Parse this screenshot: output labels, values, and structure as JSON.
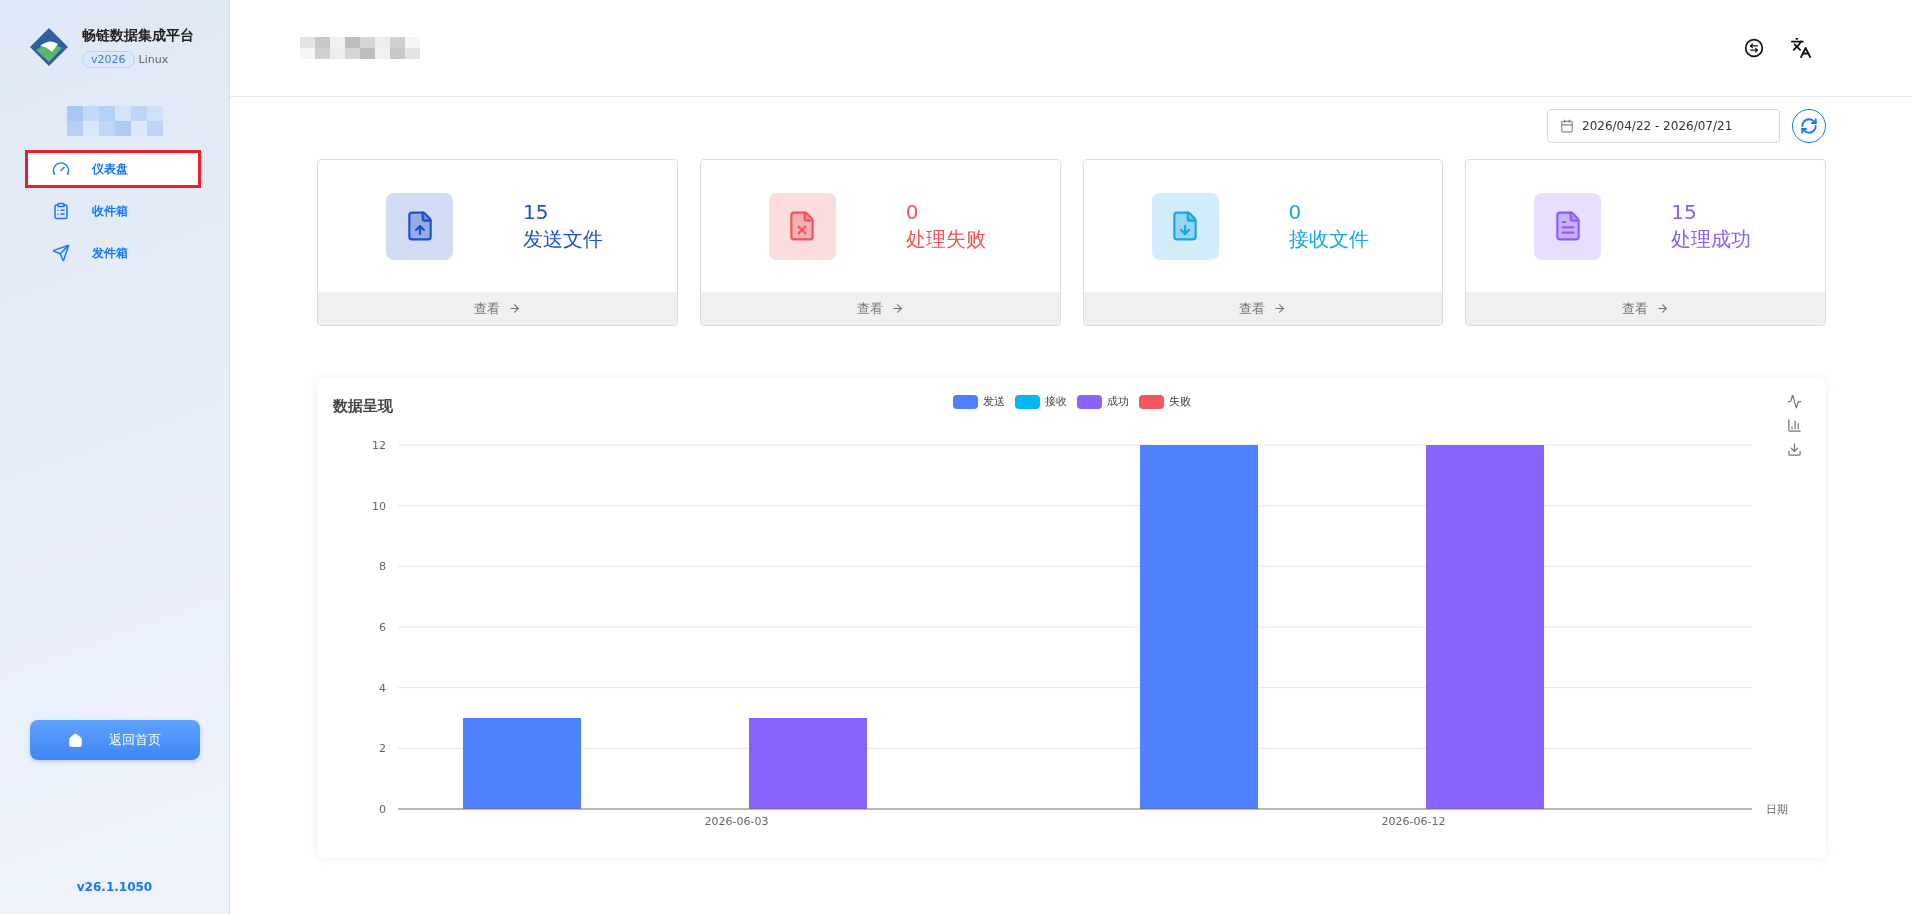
{
  "sidebar": {
    "app_title": "畅链数据集成平台",
    "version_badge": "v2026",
    "os_label": "Linux",
    "nav_items": [
      {
        "kind": "dashboard",
        "label": "仪表盘",
        "selected": true
      },
      {
        "kind": "inbox",
        "label": "收件箱",
        "selected": false
      },
      {
        "kind": "outbox",
        "label": "发件箱",
        "selected": false
      }
    ],
    "home_button": "返回首页",
    "footer_version": "v26.1.1050"
  },
  "date_range": {
    "value": "2026/04/22 - 2026/07/21"
  },
  "stat_cards": [
    {
      "kind": "send",
      "count": "15",
      "label": "发送文件",
      "color": "#1f4fc9",
      "link": "查看"
    },
    {
      "kind": "fail",
      "count": "0",
      "label": "处理失败",
      "color": "#f0545a",
      "link": "查看"
    },
    {
      "kind": "receive",
      "count": "0",
      "label": "接收文件",
      "color": "#17a6e5",
      "link": "查看"
    },
    {
      "kind": "success",
      "count": "15",
      "label": "处理成功",
      "color": "#8b5cf6",
      "link": "查看"
    }
  ],
  "chart_panel": {
    "title": "数据呈现",
    "chart_data": {
      "type": "bar",
      "xlabel": "日期",
      "categories": [
        "2026-06-03",
        "2026-06-12"
      ],
      "series": [
        {
          "name": "发送",
          "color": "#4e80ff",
          "values": [
            3,
            12
          ]
        },
        {
          "name": "接收",
          "color": "#00b8f0",
          "values": [
            0,
            0
          ]
        },
        {
          "name": "成功",
          "color": "#8a63ff",
          "values": [
            3,
            12
          ]
        },
        {
          "name": "失败",
          "color": "#f5575e",
          "values": [
            0,
            0
          ]
        }
      ],
      "grid": true,
      "ylim": [
        0,
        12
      ],
      "yticks": [
        0,
        2,
        4,
        6,
        8,
        10,
        12
      ]
    }
  }
}
